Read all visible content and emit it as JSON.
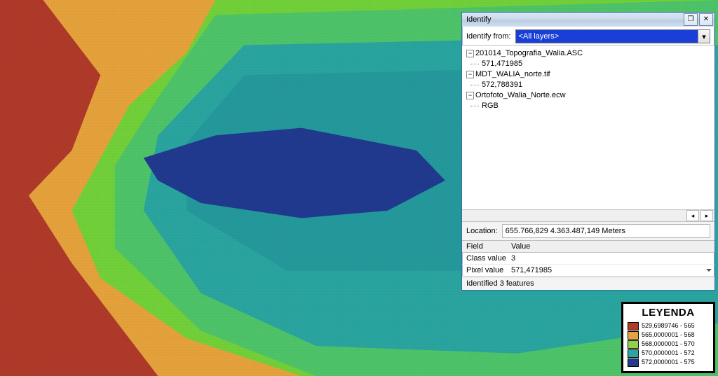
{
  "identify": {
    "title": "Identify",
    "from_label": "Identify from:",
    "from_value": "<All layers>",
    "tree": [
      {
        "label": "201014_Topografia_Walia.ASC",
        "child": "571,471985"
      },
      {
        "label": "MDT_WALIA_norte.tif",
        "child": "572,788391"
      },
      {
        "label": "Ortofoto_Walia_Norte.ecw",
        "child": "RGB"
      }
    ],
    "location_label": "Location:",
    "location_value": "655.766,829  4.363.487,149 Meters",
    "grid_headers": {
      "field": "Field",
      "value": "Value"
    },
    "grid_rows": [
      {
        "field": "Class value",
        "value": "3"
      },
      {
        "field": "Pixel value",
        "value": "571,471985"
      }
    ],
    "status": "Identified 3 features"
  },
  "legend": {
    "title": "LEYENDA",
    "items": [
      {
        "color": "#b03a2a",
        "label": "529,6989746 - 565"
      },
      {
        "color": "#e6a23c",
        "label": "565,0000001 - 568"
      },
      {
        "color": "#8fd24a",
        "label": "568,0000001 - 570"
      },
      {
        "color": "#2aa5a0",
        "label": "570,0000001 - 572"
      },
      {
        "color": "#203a8f",
        "label": "572,0000001 - 575"
      }
    ]
  },
  "glyph": {
    "minus": "−",
    "x": "✕",
    "restore": "❐",
    "down": "▾",
    "left": "◂",
    "right": "▸"
  }
}
